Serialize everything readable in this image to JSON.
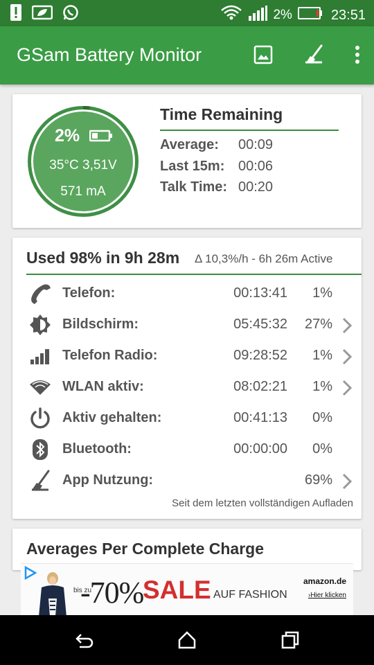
{
  "status_bar": {
    "signal_percent": "2%",
    "time": "23:51"
  },
  "app_bar": {
    "title": "GSam Battery Monitor"
  },
  "battery_card": {
    "percent": "2%",
    "temp_voltage": "35°C  3,51V",
    "current": "571 mA",
    "level_fraction": 0.02,
    "time_remaining": {
      "title": "Time Remaining",
      "rows": [
        {
          "label": "Average:",
          "value": "00:09"
        },
        {
          "label": "Last 15m:",
          "value": "00:06"
        },
        {
          "label": "Talk Time:",
          "value": "00:20"
        }
      ]
    }
  },
  "usage_card": {
    "title": "Used 98% in 9h 28m",
    "delta": "Δ 10,3%/h - 6h 26m Active",
    "rows": [
      {
        "icon": "phone-icon",
        "name": "Telefon:",
        "time": "00:13:41",
        "percent": "1%"
      },
      {
        "icon": "brightness-icon",
        "name": "Bildschirm:",
        "time": "05:45:32",
        "percent": "27%"
      },
      {
        "icon": "signal-bars-icon",
        "name": "Telefon Radio:",
        "time": "09:28:52",
        "percent": "1%"
      },
      {
        "icon": "wifi-icon",
        "name": "WLAN aktiv:",
        "time": "08:02:21",
        "percent": "1%"
      },
      {
        "icon": "power-icon",
        "name": "Aktiv gehalten:",
        "time": "00:41:13",
        "percent": "0%"
      },
      {
        "icon": "bluetooth-icon",
        "name": "Bluetooth:",
        "time": "00:00:00",
        "percent": "0%"
      },
      {
        "icon": "broom-icon",
        "name": "App Nutzung:",
        "time": "",
        "percent": "69%"
      }
    ],
    "footnote": "Seit dem letzten vollständigen Aufladen"
  },
  "averages_card": {
    "title": "Averages Per Complete Charge"
  },
  "ad": {
    "small": "bis zu",
    "big": "-70%",
    "sale": "SALE",
    "fashion": "AUF FASHION",
    "brand": "amazon.de",
    "cta": "›Hier klicken"
  },
  "colors": {
    "status_bar": "#2e7d32",
    "app_bar": "#3a9c45",
    "gauge_fill": "#5aa65e",
    "accent_line": "#3a8c3f"
  }
}
